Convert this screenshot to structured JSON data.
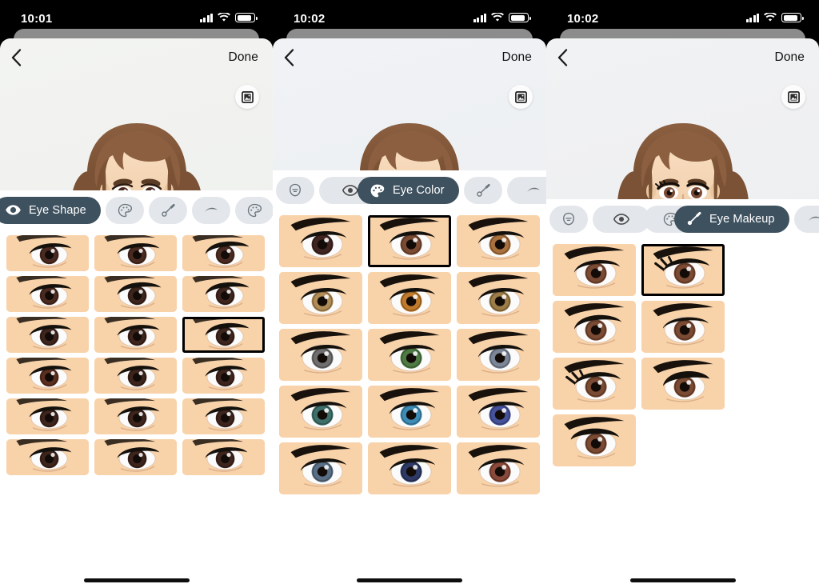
{
  "app": {
    "title": "Memoji Editor",
    "panels": [
      {
        "id": "panel-eye-shape",
        "status": {
          "time": "10:01",
          "signal_icon": "cellular-signal-icon",
          "wifi_icon": "wifi-icon",
          "battery_icon": "battery-icon"
        },
        "nav": {
          "back_icon": "chevron-left-icon",
          "done_label": "Done"
        },
        "background_button_icon": "photo-frame-icon",
        "active_tab": "Eye Shape",
        "tabs": [
          {
            "label": "",
            "icon": "head-shape-icon",
            "active": false,
            "partial": true
          },
          {
            "label": "Eye Shape",
            "icon": "eye-icon",
            "active": true
          },
          {
            "label": "",
            "icon": "palette-icon",
            "active": false
          },
          {
            "label": "",
            "icon": "makeup-brush-icon",
            "active": false
          },
          {
            "label": "",
            "icon": "eyebrow-icon",
            "active": false
          },
          {
            "label": "",
            "icon": "palette-icon",
            "active": false,
            "partial": true
          }
        ],
        "grid": {
          "selected_index": 8,
          "columns": 3,
          "items": [
            {
              "name": "eye-shape-1",
              "iris": "#4a2a20",
              "lash": "tapered",
              "tilt": 0
            },
            {
              "name": "eye-shape-2",
              "iris": "#4a2a20",
              "lash": "tapered",
              "tilt": 0
            },
            {
              "name": "eye-shape-3",
              "iris": "#4a2a20",
              "lash": "thick",
              "tilt": 0
            },
            {
              "name": "eye-shape-4",
              "iris": "#4a2a20",
              "lash": "round",
              "tilt": 0
            },
            {
              "name": "eye-shape-5",
              "iris": "#3d241c",
              "lash": "thick",
              "tilt": 0
            },
            {
              "name": "eye-shape-6",
              "iris": "#3d241c",
              "lash": "thick",
              "tilt": 0
            },
            {
              "name": "eye-shape-7",
              "iris": "#3d241c",
              "lash": "narrow",
              "tilt": 0
            },
            {
              "name": "eye-shape-8",
              "iris": "#3d241c",
              "lash": "narrow",
              "tilt": 0
            },
            {
              "name": "eye-shape-9",
              "iris": "#3d241c",
              "lash": "thick",
              "tilt": 0
            },
            {
              "name": "eye-shape-10",
              "iris": "#5b2f20",
              "lash": "tapered",
              "tilt": 0
            },
            {
              "name": "eye-shape-11",
              "iris": "#3d241c",
              "lash": "tapered",
              "tilt": 0
            },
            {
              "name": "eye-shape-12",
              "iris": "#3d241c",
              "lash": "tapered",
              "tilt": 0
            },
            {
              "name": "eye-shape-13",
              "iris": "#3d241c",
              "lash": "round",
              "tilt": 0
            },
            {
              "name": "eye-shape-14",
              "iris": "#3d241c",
              "lash": "round",
              "tilt": 0
            },
            {
              "name": "eye-shape-15",
              "iris": "#3d241c",
              "lash": "round",
              "tilt": 0
            },
            {
              "name": "eye-shape-16",
              "iris": "#3d241c",
              "lash": "round",
              "tilt": 0
            },
            {
              "name": "eye-shape-17",
              "iris": "#3d241c",
              "lash": "round",
              "tilt": 0
            },
            {
              "name": "eye-shape-18",
              "iris": "#3d241c",
              "lash": "round",
              "tilt": 0
            }
          ]
        }
      },
      {
        "id": "panel-eye-color",
        "status": {
          "time": "10:02",
          "signal_icon": "cellular-signal-icon",
          "wifi_icon": "wifi-icon",
          "battery_icon": "battery-icon"
        },
        "nav": {
          "back_icon": "chevron-left-icon",
          "done_label": "Done"
        },
        "background_button_icon": "photo-frame-icon",
        "active_tab": "Eye Color",
        "tabs": [
          {
            "label": "",
            "icon": "head-shape-icon",
            "active": false
          },
          {
            "label": "",
            "icon": "eye-icon",
            "active": false
          },
          {
            "label": "Eye Color",
            "icon": "palette-icon",
            "active": true
          },
          {
            "label": "",
            "icon": "makeup-brush-icon",
            "active": false
          },
          {
            "label": "",
            "icon": "eyebrow-icon",
            "active": false
          }
        ],
        "grid": {
          "selected_index": 1,
          "columns": 3,
          "items": [
            {
              "name": "eye-color-dark-brown",
              "iris": "#402420"
            },
            {
              "name": "eye-color-brown",
              "iris": "#7b4a33"
            },
            {
              "name": "eye-color-light-brown",
              "iris": "#a9713d"
            },
            {
              "name": "eye-color-tan",
              "iris": "#b08c57"
            },
            {
              "name": "eye-color-amber",
              "iris": "#c07a2c"
            },
            {
              "name": "eye-color-hazel",
              "iris": "#9c7c47"
            },
            {
              "name": "eye-color-gray",
              "iris": "#6f6f70"
            },
            {
              "name": "eye-color-green",
              "iris": "#4f7a43"
            },
            {
              "name": "eye-color-blue-gray",
              "iris": "#7c8697"
            },
            {
              "name": "eye-color-teal",
              "iris": "#3f6f6a"
            },
            {
              "name": "eye-color-light-blue",
              "iris": "#3e8bb5"
            },
            {
              "name": "eye-color-blue",
              "iris": "#45519a"
            },
            {
              "name": "eye-color-steel-blue",
              "iris": "#5a6f85"
            },
            {
              "name": "eye-color-navy",
              "iris": "#2e3a66"
            },
            {
              "name": "eye-color-heterochromia",
              "iris": "#8a4a3a"
            }
          ]
        }
      },
      {
        "id": "panel-eye-makeup",
        "status": {
          "time": "10:02",
          "signal_icon": "cellular-signal-icon",
          "wifi_icon": "wifi-icon",
          "battery_icon": "battery-icon"
        },
        "nav": {
          "back_icon": "chevron-left-icon",
          "done_label": "Done"
        },
        "background_button_icon": "photo-frame-icon",
        "active_tab": "Eye Makeup",
        "tabs": [
          {
            "label": "",
            "icon": "head-shape-icon",
            "active": false
          },
          {
            "label": "",
            "icon": "eye-icon",
            "active": false
          },
          {
            "label": "",
            "icon": "palette-icon",
            "active": false
          },
          {
            "label": "Eye Makeup",
            "icon": "makeup-brush-icon",
            "active": true
          },
          {
            "label": "",
            "icon": "eyebrow-icon",
            "active": false,
            "partial": true
          }
        ],
        "grid": {
          "selected_index": 1,
          "columns": 3,
          "items": [
            {
              "name": "eye-makeup-none",
              "liner": "none"
            },
            {
              "name": "eye-makeup-lashes",
              "liner": "lashes"
            },
            {
              "name": "eye-makeup-wing",
              "liner": "wing"
            },
            {
              "name": "eye-makeup-thin-liner",
              "liner": "thin"
            },
            {
              "name": "eye-makeup-long-lashes",
              "liner": "long-lashes"
            },
            {
              "name": "eye-makeup-smoky",
              "liner": "smoky"
            },
            {
              "name": "eye-makeup-cat-eye",
              "liner": "cat-eye"
            }
          ]
        }
      }
    ]
  }
}
